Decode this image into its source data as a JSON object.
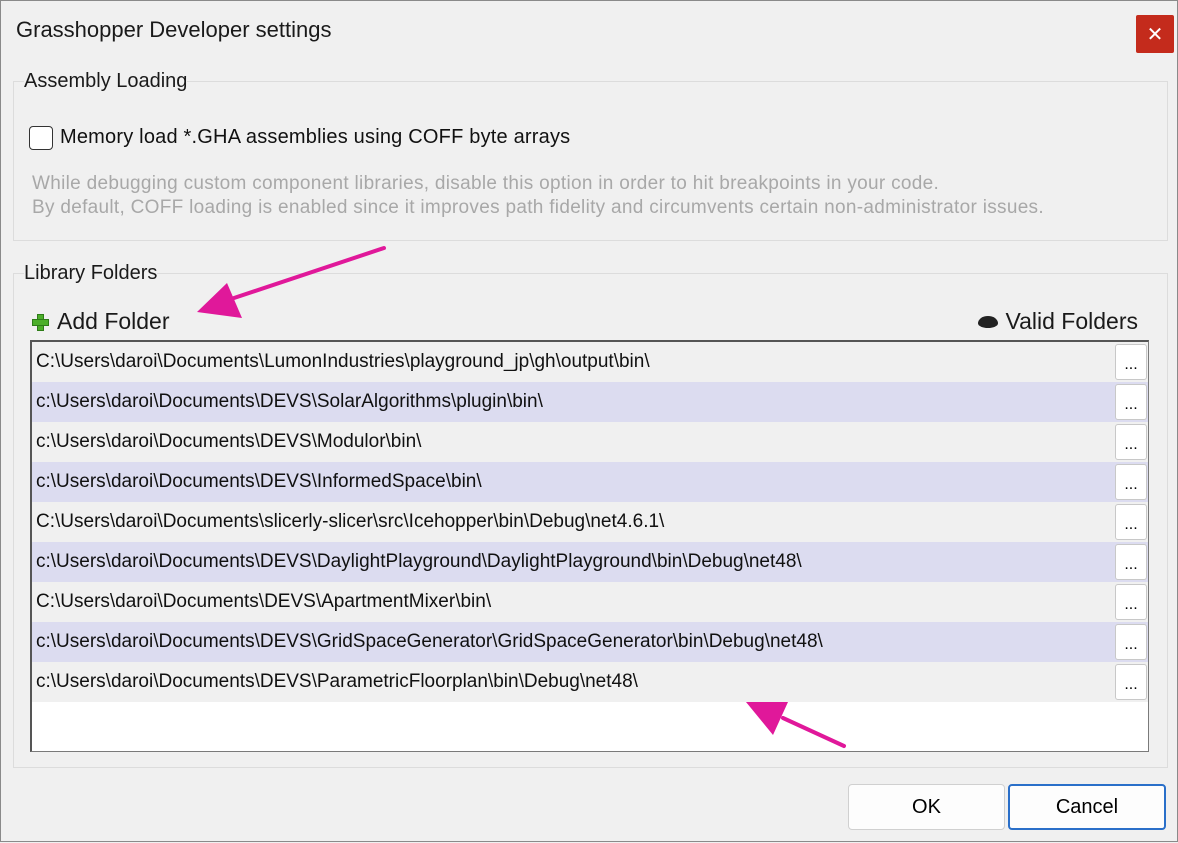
{
  "window": {
    "title": "Grasshopper Developer settings",
    "close_glyph": "✕"
  },
  "assembly": {
    "group_title": "Assembly Loading",
    "checkbox_label": "Memory load *.GHA assemblies using COFF byte arrays",
    "checkbox_checked": false,
    "hint_line1": "While debugging custom component libraries, disable this option in order to hit breakpoints in your code.",
    "hint_line2": "By default, COFF loading is enabled since it improves path fidelity and circumvents certain non-administrator issues."
  },
  "library": {
    "group_title": "Library Folders",
    "add_folder_label": "Add Folder",
    "add_folder_icon": "plus-icon",
    "valid_folders_label": "Valid Folders",
    "valid_folders_icon": "eye-icon",
    "browse_label": "...",
    "folders": [
      "C:\\Users\\daroi\\Documents\\LumonIndustries\\playground_jp\\gh\\output\\bin\\",
      "c:\\Users\\daroi\\Documents\\DEVS\\SolarAlgorithms\\plugin\\bin\\",
      "c:\\Users\\daroi\\Documents\\DEVS\\Modulor\\bin\\",
      "c:\\Users\\daroi\\Documents\\DEVS\\InformedSpace\\bin\\",
      "C:\\Users\\daroi\\Documents\\slicerly-slicer\\src\\Icehopper\\bin\\Debug\\net4.6.1\\",
      "c:\\Users\\daroi\\Documents\\DEVS\\DaylightPlayground\\DaylightPlayground\\bin\\Debug\\net48\\",
      "C:\\Users\\daroi\\Documents\\DEVS\\ApartmentMixer\\bin\\",
      "c:\\Users\\daroi\\Documents\\DEVS\\GridSpaceGenerator\\GridSpaceGenerator\\bin\\Debug\\net48\\",
      "c:\\Users\\daroi\\Documents\\DEVS\\ParametricFloorplan\\bin\\Debug\\net48\\"
    ]
  },
  "buttons": {
    "ok_label": "OK",
    "cancel_label": "Cancel"
  },
  "colors": {
    "annotation_arrow": "#e0189a",
    "close_button": "#c42b1c",
    "row_alt": "#dcdcf0",
    "focus_border": "#2a6fc9"
  }
}
